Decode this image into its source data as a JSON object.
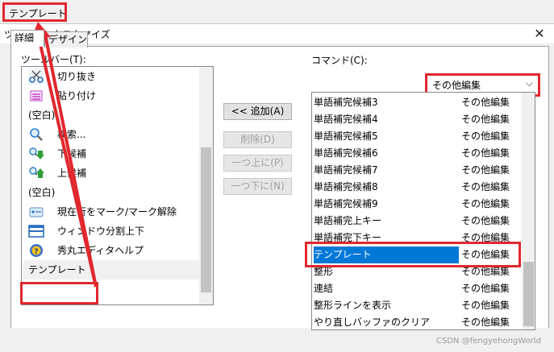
{
  "top_button": {
    "label": "テンプレート"
  },
  "dialog": {
    "title": "ツールバーカスタマイズ",
    "close_glyph": "✕",
    "tabs": [
      {
        "label": "詳細"
      },
      {
        "label": "デザイン"
      }
    ],
    "toolbar_label": "ツールバー(T):",
    "command_label": "コマンド(C):",
    "toolbar_items": [
      {
        "label": "切り抜き",
        "icon": "scissors-icon"
      },
      {
        "label": "貼り付け",
        "icon": "paste-icon"
      },
      {
        "label": "(空白)",
        "icon": ""
      },
      {
        "label": "検索...",
        "icon": "magnifier-icon"
      },
      {
        "label": "下候補",
        "icon": "search-down-icon"
      },
      {
        "label": "上候補",
        "icon": "search-up-icon"
      },
      {
        "label": "(空白)",
        "icon": ""
      },
      {
        "label": "現在行をマーク/マーク解除",
        "icon": "mark-icon"
      },
      {
        "label": "ウィンドウ分割上下",
        "icon": "split-window-icon"
      },
      {
        "label": "秀丸エディタヘルプ",
        "icon": "help-icon"
      },
      {
        "label": "テンプレート",
        "icon": ""
      }
    ],
    "buttons": {
      "add": "<< 追加(A)",
      "delete": "削除(D)",
      "up": "一つ上に(P)",
      "down": "一つ下に(N)"
    },
    "command_category": {
      "selected": "その他編集"
    },
    "commands": [
      {
        "name": "単語補完候補3",
        "category": "その他編集"
      },
      {
        "name": "単語補完候補4",
        "category": "その他編集"
      },
      {
        "name": "単語補完候補5",
        "category": "その他編集"
      },
      {
        "name": "単語補完候補6",
        "category": "その他編集"
      },
      {
        "name": "単語補完候補7",
        "category": "その他編集"
      },
      {
        "name": "単語補完候補8",
        "category": "その他編集"
      },
      {
        "name": "単語補完候補9",
        "category": "その他編集"
      },
      {
        "name": "単語補完上キー",
        "category": "その他編集"
      },
      {
        "name": "単語補完下キー",
        "category": "その他編集"
      },
      {
        "name": "テンプレート",
        "category": "その他編集"
      },
      {
        "name": "整形",
        "category": "その他編集"
      },
      {
        "name": "連結",
        "category": "その他編集"
      },
      {
        "name": "整形ラインを表示",
        "category": "その他編集"
      },
      {
        "name": "やり直しバッファのクリア",
        "category": "その他編集"
      }
    ],
    "selected_command_index": 9
  },
  "watermark": "CSDN @fengyehongWorld",
  "colors": {
    "annotation_red": "#e0282e",
    "selection_blue": "#0078d7",
    "dialog_bg": "#f0f0f0"
  }
}
